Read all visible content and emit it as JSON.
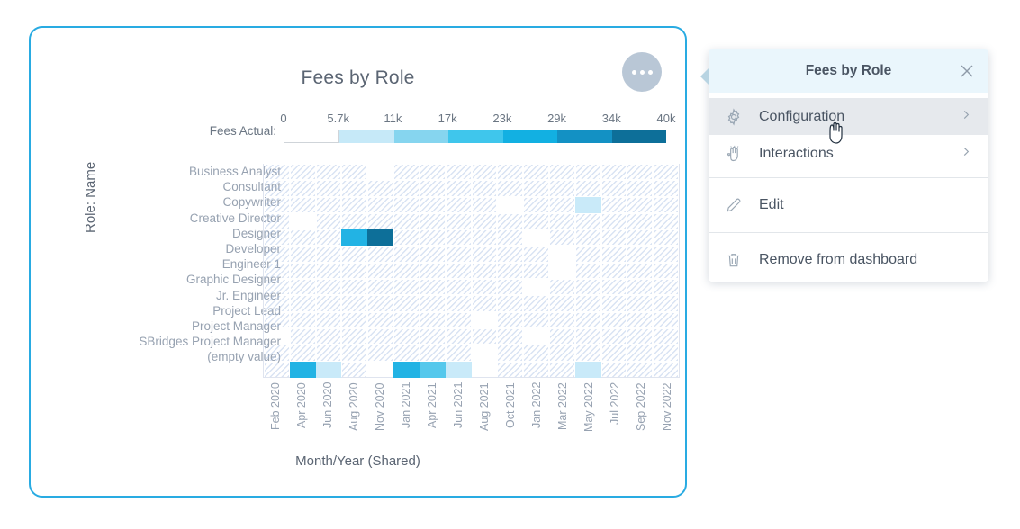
{
  "card": {
    "title": "Fees by Role",
    "menu_button": "more-options",
    "border_color": "#29ABE2"
  },
  "legend": {
    "label": "Fees Actual:",
    "ticks": [
      "0",
      "5.7k",
      "11k",
      "17k",
      "23k",
      "29k",
      "34k",
      "40k"
    ],
    "colors": [
      "#ffffff",
      "#c6e9f8",
      "#86d5ef",
      "#3fc6ec",
      "#12b0e2",
      "#1391c4",
      "#0d6f99"
    ]
  },
  "chart_data": {
    "type": "heatmap",
    "title": "Fees by Role",
    "xlabel": "Month/Year (Shared)",
    "ylabel": "Role: Name",
    "legend_title": "Fees Actual:",
    "legend_position": "top",
    "color_scale_stops": [
      0,
      5700,
      11000,
      17000,
      23000,
      29000,
      34000,
      40000
    ],
    "grid": true,
    "null_cell_style": "diagonal-hatch",
    "categories_y": [
      "Business Analyst",
      "Consultant",
      "Copywriter",
      "Creative Director",
      "Designer",
      "Developer",
      "Engineer 1",
      "Graphic Designer",
      "Jr. Engineer",
      "Project Lead",
      "Project Manager",
      "SBridges Project Manager",
      "(empty value)"
    ],
    "categories_x": [
      "Feb 2020",
      "Apr 2020",
      "Jun 2020",
      "Aug 2020",
      "Nov 2020",
      "Jan 2021",
      "Apr 2021",
      "Jun 2021",
      "Aug 2021",
      "Oct 2021",
      "Jan 2022",
      "Mar 2022",
      "May 2022",
      "Jul 2022",
      "Sep 2022",
      "Nov 2022"
    ],
    "cell_matrix": [
      [
        "n",
        "n",
        "n",
        "n",
        "b",
        "n",
        "n",
        "n",
        "n",
        "n",
        "n",
        "n",
        "n",
        "n",
        "n",
        "n"
      ],
      [
        "n",
        "n",
        "n",
        "n",
        "n",
        "n",
        "n",
        "n",
        "n",
        "n",
        "n",
        "n",
        "n",
        "n",
        "n",
        "n"
      ],
      [
        "n",
        "n",
        "n",
        "n",
        "n",
        "n",
        "n",
        "n",
        "n",
        "b",
        "n",
        "n",
        "v1",
        "n",
        "n",
        "n"
      ],
      [
        "n",
        "b",
        "n",
        "n",
        "n",
        "n",
        "n",
        "n",
        "n",
        "n",
        "n",
        "n",
        "n",
        "n",
        "n",
        "n"
      ],
      [
        "n",
        "n",
        "n",
        "v2",
        "v3",
        "n",
        "n",
        "n",
        "n",
        "n",
        "b",
        "n",
        "n",
        "n",
        "n",
        "n"
      ],
      [
        "n",
        "n",
        "n",
        "n",
        "n",
        "n",
        "n",
        "n",
        "n",
        "n",
        "n",
        "b",
        "n",
        "n",
        "n",
        "n"
      ],
      [
        "n",
        "n",
        "n",
        "n",
        "n",
        "n",
        "n",
        "n",
        "n",
        "n",
        "n",
        "b",
        "n",
        "n",
        "n",
        "n"
      ],
      [
        "n",
        "n",
        "n",
        "n",
        "n",
        "n",
        "n",
        "n",
        "n",
        "n",
        "b",
        "n",
        "n",
        "n",
        "n",
        "n"
      ],
      [
        "n",
        "n",
        "n",
        "n",
        "n",
        "n",
        "n",
        "n",
        "n",
        "n",
        "n",
        "n",
        "n",
        "n",
        "n",
        "n"
      ],
      [
        "n",
        "n",
        "n",
        "n",
        "n",
        "n",
        "n",
        "n",
        "b",
        "n",
        "n",
        "n",
        "n",
        "n",
        "n",
        "n"
      ],
      [
        "b",
        "n",
        "n",
        "n",
        "n",
        "n",
        "n",
        "n",
        "n",
        "n",
        "b",
        "n",
        "n",
        "n",
        "n",
        "n"
      ],
      [
        "n",
        "n",
        "n",
        "n",
        "n",
        "n",
        "n",
        "n",
        "b",
        "n",
        "n",
        "n",
        "n",
        "n",
        "n",
        "n"
      ],
      [
        "n",
        "v4",
        "v5",
        "n",
        "b",
        "v6",
        "v7",
        "v8",
        "b",
        "n",
        "n",
        "n",
        "v1",
        "n",
        "n",
        "n"
      ]
    ],
    "cell_values": {
      "v1": {
        "color": "#c9eaf9",
        "approx_value": 2500
      },
      "v2": {
        "color": "#22b3e4",
        "approx_value": 26000
      },
      "v3": {
        "color": "#0d6f99",
        "approx_value": 38000
      },
      "v4": {
        "color": "#22b3e4",
        "approx_value": 26000
      },
      "v5": {
        "color": "#c9eaf9",
        "approx_value": 2500
      },
      "v6": {
        "color": "#22b3e4",
        "approx_value": 26000
      },
      "v7": {
        "color": "#55c8ec",
        "approx_value": 14000
      },
      "v8": {
        "color": "#c9eaf9",
        "approx_value": 2500
      }
    },
    "legend_note": "n = no-data hatched cell, b = blank cell, vN = colored value cell"
  },
  "context_menu": {
    "title": "Fees by Role",
    "close_icon": "close-icon",
    "items": [
      {
        "label": "Configuration",
        "icon": "gear-icon",
        "has_submenu": true,
        "hovered": true
      },
      {
        "label": "Interactions",
        "icon": "hand-pointer-icon",
        "has_submenu": true,
        "hovered": false
      },
      {
        "label": "Edit",
        "icon": "pencil-icon",
        "has_submenu": false,
        "hovered": false
      },
      {
        "label": "Remove from dashboard",
        "icon": "trash-icon",
        "has_submenu": false,
        "hovered": false
      }
    ]
  }
}
